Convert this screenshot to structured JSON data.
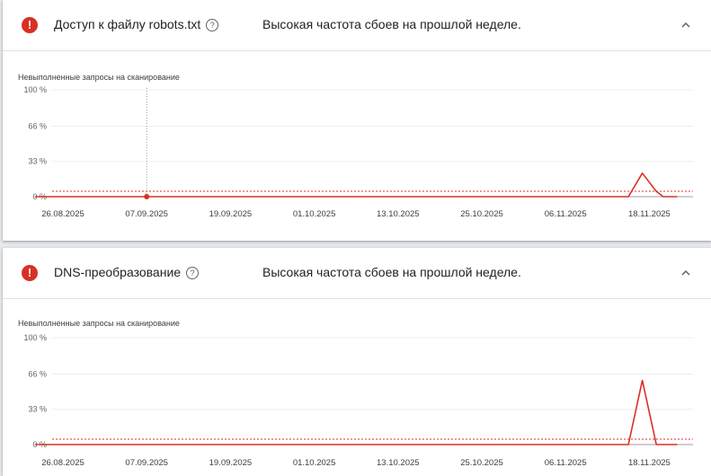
{
  "cards": [
    {
      "title": "Доступ к файлу robots.txt",
      "status": "Высокая частота сбоев на прошлой неделе.",
      "help_glyph": "?",
      "alert_glyph": "!",
      "icon": "alert-icon",
      "chevron": "chevron-up-icon"
    },
    {
      "title": "DNS-преобразование",
      "status": "Высокая частота сбоев на прошлой неделе.",
      "help_glyph": "?",
      "alert_glyph": "!",
      "icon": "alert-icon",
      "chevron": "chevron-up-icon"
    }
  ],
  "colors": {
    "alert": "#d93025",
    "line": "#d93025",
    "grid": "#eeeeee"
  },
  "chart_data": [
    {
      "type": "line",
      "ylabel": "Невыполненные запросы на сканирование",
      "yticks": [
        "0 %",
        "33 %",
        "66 %",
        "100 %"
      ],
      "ylim": [
        0,
        100
      ],
      "xtick_labels": [
        "26.08.2025",
        "07.09.2025",
        "19.09.2025",
        "01.10.2025",
        "13.10.2025",
        "25.10.2025",
        "06.11.2025",
        "18.11.2025"
      ],
      "x_start": "2025-08-22",
      "x_end": "2025-11-22",
      "threshold": 5,
      "series": [
        {
          "points": [
            [
              "2025-08-22",
              0
            ],
            [
              "2025-11-15",
              0
            ],
            [
              "2025-11-17",
              22
            ],
            [
              "2025-11-19",
              5
            ],
            [
              "2025-11-20",
              0
            ],
            [
              "2025-11-22",
              0
            ]
          ]
        }
      ],
      "highlight_point": [
        "2025-09-07",
        0
      ],
      "cursor_date": "2025-09-07"
    },
    {
      "type": "line",
      "ylabel": "Невыполненные запросы на сканирование",
      "yticks": [
        "0 %",
        "33 %",
        "66 %",
        "100 %"
      ],
      "ylim": [
        0,
        100
      ],
      "xtick_labels": [
        "26.08.2025",
        "07.09.2025",
        "19.09.2025",
        "01.10.2025",
        "13.10.2025",
        "25.10.2025",
        "06.11.2025",
        "18.11.2025"
      ],
      "x_start": "2025-08-22",
      "x_end": "2025-11-22",
      "threshold": 5,
      "series": [
        {
          "points": [
            [
              "2025-08-22",
              0
            ],
            [
              "2025-11-15",
              0
            ],
            [
              "2025-11-17",
              60
            ],
            [
              "2025-11-19",
              0
            ],
            [
              "2025-11-22",
              0
            ]
          ]
        }
      ]
    }
  ]
}
